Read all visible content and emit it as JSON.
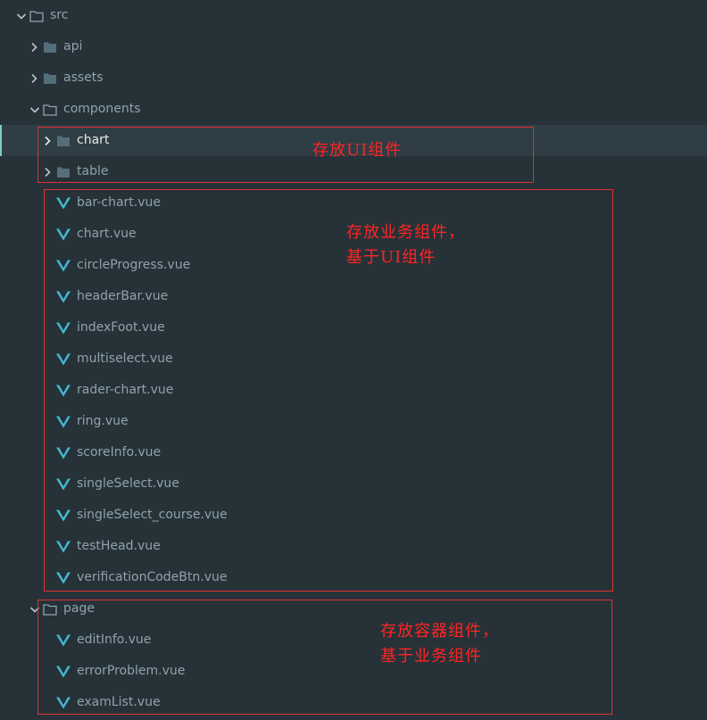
{
  "colors": {
    "background": "#263238",
    "selected_row": "#2f3d44",
    "text": "#8fa3ab",
    "vue_icon": "#42b9d4",
    "annotation": "#ff2424"
  },
  "tree": {
    "src": {
      "label": "src",
      "expanded": true,
      "icon": "folder-open-icon"
    },
    "api": {
      "label": "api",
      "expanded": false,
      "icon": "folder-icon"
    },
    "assets": {
      "label": "assets",
      "expanded": false,
      "icon": "folder-icon"
    },
    "components": {
      "label": "components",
      "expanded": true,
      "icon": "folder-open-icon"
    },
    "chart": {
      "label": "chart",
      "expanded": false,
      "selected": true,
      "icon": "folder-icon"
    },
    "table": {
      "label": "table",
      "expanded": false,
      "icon": "folder-icon"
    },
    "component_files": [
      "bar-chart.vue",
      "chart.vue",
      "circleProgress.vue",
      "headerBar.vue",
      "indexFoot.vue",
      "multiselect.vue",
      "rader-chart.vue",
      "ring.vue",
      "scoreInfo.vue",
      "singleSelect.vue",
      "singleSelect_course.vue",
      "testHead.vue",
      "verificationCodeBtn.vue"
    ],
    "page": {
      "label": "page",
      "expanded": true,
      "icon": "folder-open-icon"
    },
    "page_files": [
      "editInfo.vue",
      "errorProblem.vue",
      "examList.vue"
    ]
  },
  "annotations": {
    "ui_components": "存放UI组件",
    "business_line1": "存放业务组件，",
    "business_line2": "基于UI组件",
    "container_line1": "存放容器组件，",
    "container_line2": "基于业务组件"
  }
}
